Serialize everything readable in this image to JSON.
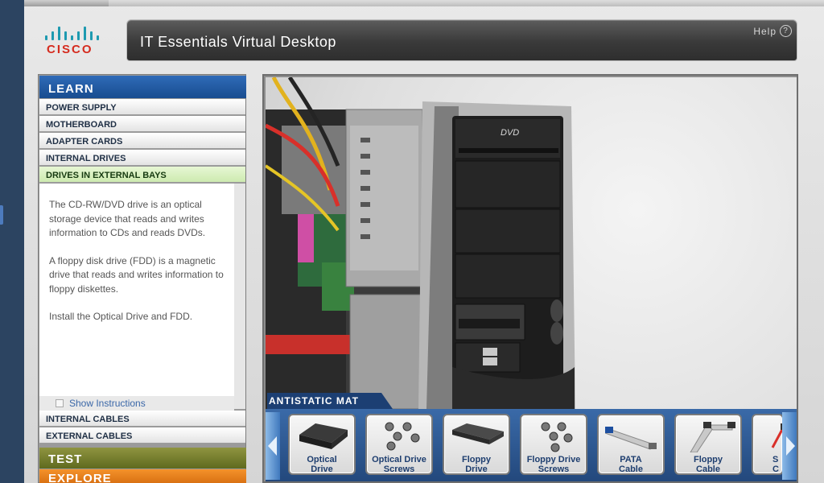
{
  "app": {
    "title": "IT Essentials Virtual Desktop",
    "help_label": "Help",
    "help_icon": "?",
    "logo_text": "CISCO"
  },
  "sidebar": {
    "learn_label": "LEARN",
    "items": [
      {
        "label": "POWER SUPPLY"
      },
      {
        "label": "MOTHERBOARD"
      },
      {
        "label": "ADAPTER CARDS"
      },
      {
        "label": "INTERNAL DRIVES"
      },
      {
        "label": "DRIVES IN EXTERNAL BAYS",
        "active": true
      }
    ],
    "description": [
      "The CD-RW/DVD drive is an optical storage device that reads and writes information to CDs and reads DVDs.",
      "A floppy disk drive (FDD) is a magnetic drive that reads and writes information to floppy diskettes.",
      "Install the Optical Drive and FDD."
    ],
    "show_instructions_label": "Show Instructions",
    "bottom_items": [
      {
        "label": "INTERNAL CABLES"
      },
      {
        "label": "EXTERNAL CABLES"
      }
    ],
    "test_label": "TEST",
    "explore_label": "EXPLORE"
  },
  "scene": {
    "mat_label": "ANTISTATIC MAT",
    "dvd_logo": "DVD"
  },
  "tray": {
    "parts": [
      {
        "line1": "Optical",
        "line2": "Drive"
      },
      {
        "line1": "Optical Drive",
        "line2": "Screws"
      },
      {
        "line1": "Floppy",
        "line2": "Drive"
      },
      {
        "line1": "Floppy Drive",
        "line2": "Screws"
      },
      {
        "line1": "PATA",
        "line2": "Cable"
      },
      {
        "line1": "Floppy",
        "line2": "Cable"
      },
      {
        "line1": "S",
        "line2": "C"
      }
    ]
  }
}
